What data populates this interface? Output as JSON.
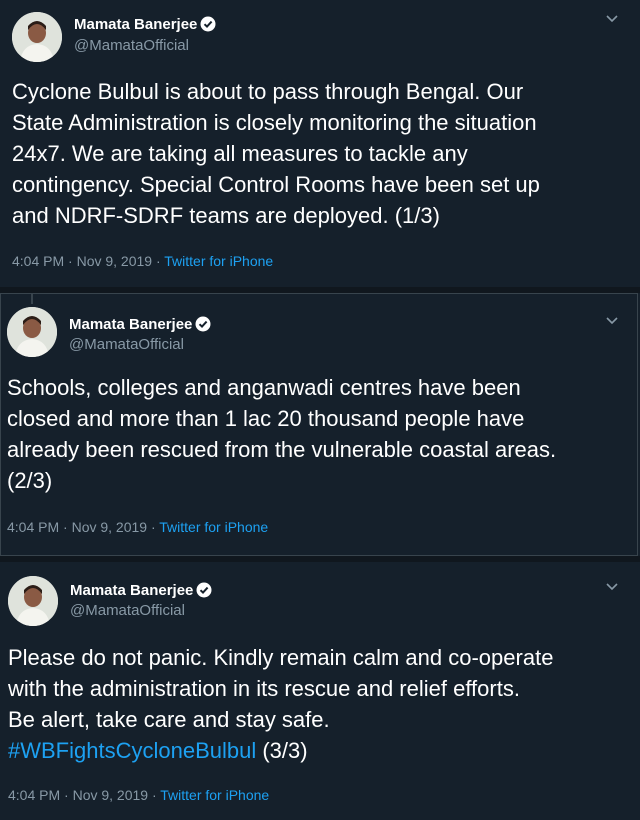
{
  "tweets": [
    {
      "author": {
        "name": "Mamata Banerjee",
        "handle": "@MamataOfficial",
        "verified": true
      },
      "lines": [
        "Cyclone Bulbul is about to pass through Bengal. Our",
        "State Administration is closely monitoring the situation",
        "24x7. We are taking all measures to tackle any",
        "contingency. Special Control Rooms have been set up",
        "and NDRF-SDRF teams are deployed. (1/3)"
      ],
      "timestamp": "4:04 PM · Nov 9, 2019 · ",
      "source": "Twitter for iPhone"
    },
    {
      "author": {
        "name": "Mamata Banerjee",
        "handle": "@MamataOfficial",
        "verified": true
      },
      "lines": [
        "Schools, colleges and anganwadi centres have been",
        "closed and more than 1 lac 20 thousand people have",
        "already been rescued from the vulnerable coastal areas.",
        "(2/3)"
      ],
      "timestamp": "4:04 PM · Nov 9, 2019 · ",
      "source": "Twitter for iPhone"
    },
    {
      "author": {
        "name": "Mamata Banerjee",
        "handle": "@MamataOfficial",
        "verified": true
      },
      "lines": [
        "Please do not panic. Kindly remain calm and co-operate",
        "with the administration in its rescue and relief efforts.",
        "Be alert, take care and stay safe."
      ],
      "hashtag": "#WBFightsCycloneBulbul",
      "hashtag_suffix": " (3/3)",
      "timestamp": "4:04 PM · Nov 9, 2019 · ",
      "source": "Twitter for iPhone"
    }
  ],
  "colors": {
    "background": "#15202b",
    "text": "#ffffff",
    "muted": "#8899a6",
    "accent": "#1da1f2"
  },
  "icons": {
    "verified": "verified-badge-icon",
    "more": "chevron-down-icon"
  }
}
